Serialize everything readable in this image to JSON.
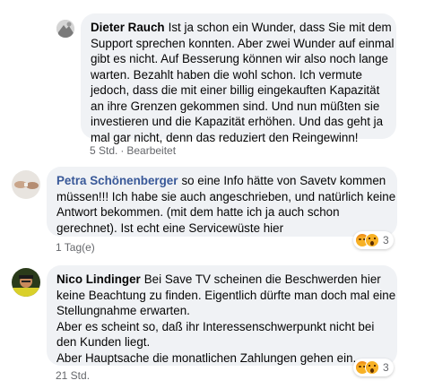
{
  "top_partial": "5 Std. · Bearbeitet",
  "comments": [
    {
      "author": "Dieter Rauch",
      "lines": [
        "Ist ja schon ein Wunder, dass Sie mit dem",
        "Support sprechen konnten. Aber zwei Wunder auf einmal",
        "gibt es nicht. Auf Besserung können wir also noch lange",
        "warten. Bezahlt haben die wohl schon. Ich vermute",
        "jedoch, dass die mit einer billig eingekauften Kapazität",
        "an ihre Grenzen gekommen sind. Und nun müßten sie",
        "investieren und die Kapazität erhöhen. Und das geht ja",
        "mal gar nicht, denn das reduziert den Reingewinn!"
      ],
      "time": "5 Std.",
      "edited": "Bearbeitet"
    },
    {
      "author": "Petra Schönenberger",
      "lines": [
        "so eine Info hätte von Savetv kommen",
        "müssen!!! Ich habe sie auch angeschrieben, und natürlich keine",
        "Antwort bekommen. (mit dem hatte ich ja auch schon",
        "gerechnet). Ist echt eine Servicewüste hier"
      ],
      "time": "1 Tag(e)",
      "reaction_count": "3"
    },
    {
      "author": "Nico Lindinger",
      "lines": [
        "Bei Save TV scheinen die Beschwerden hier",
        "keine Beachtung zu finden. Eigentlich dürfte man doch mal eine",
        "Stellungnahme erwarten.",
        "Aber es scheint so, daß ihr Interessenschwerpunkt nicht bei",
        "den Kunden liegt.",
        "Aber Hauptsache die monatlichen Zahlungen gehen ein."
      ],
      "time": "21 Std.",
      "reaction_count": "3"
    }
  ]
}
